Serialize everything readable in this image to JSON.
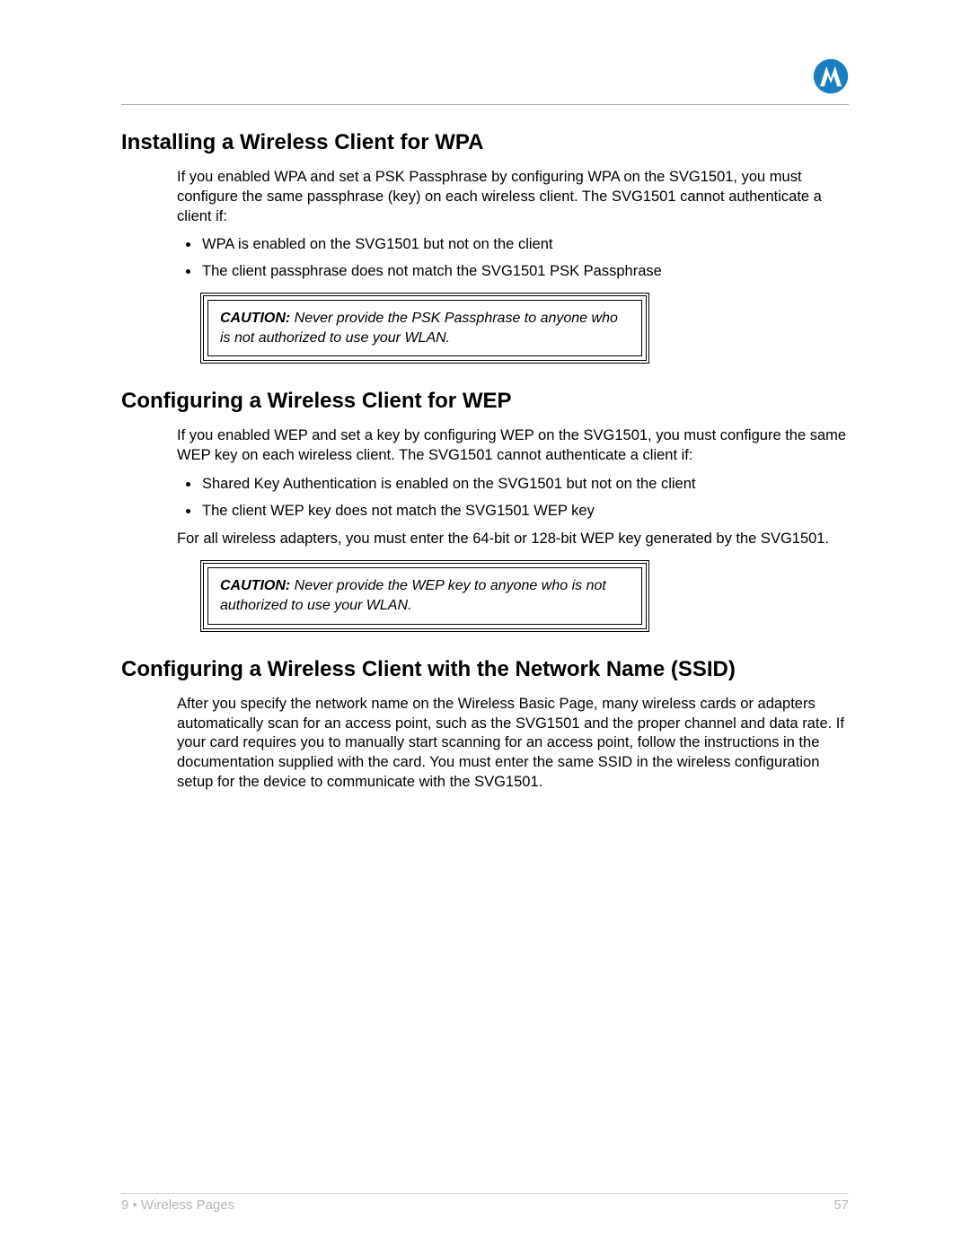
{
  "sections": [
    {
      "heading": "Installing a Wireless Client for WPA",
      "intro": "If you enabled WPA and set a PSK Passphrase by configuring WPA on the SVG1501, you must configure the same passphrase (key) on each wireless client. The SVG1501 cannot authenticate a client if:",
      "bullets": [
        "WPA is enabled on the SVG1501 but not on the client",
        "The client passphrase does not match the SVG1501 PSK Passphrase"
      ],
      "after": "",
      "caution_label": "CAUTION:",
      "caution_text": " Never provide the PSK Passphrase to anyone who is not authorized to use your WLAN."
    },
    {
      "heading": "Configuring a Wireless Client for WEP",
      "intro": "If you enabled WEP and set a key by configuring WEP on the SVG1501, you must configure the same WEP key on each wireless client. The SVG1501 cannot authenticate a client if:",
      "bullets": [
        "Shared Key Authentication is enabled on the SVG1501 but not on the client",
        "The client WEP key does not match the SVG1501 WEP key"
      ],
      "after": "For all wireless adapters, you must enter the 64-bit or 128-bit WEP key generated by the SVG1501.",
      "caution_label": "CAUTION:",
      "caution_text": " Never provide the WEP key to anyone who is not authorized to use your WLAN."
    },
    {
      "heading": "Configuring a Wireless Client with the Network Name (SSID)",
      "intro": "After you specify the network name on the Wireless Basic Page, many wireless cards or adapters automatically scan for an access point, such as the SVG1501 and the proper channel and data rate. If your card requires you to manually start scanning for an access point, follow the instructions in the documentation supplied with the card. You must enter the same SSID in the wireless configuration setup for the device to communicate with the SVG1501.",
      "bullets": [],
      "after": "",
      "caution_label": "",
      "caution_text": ""
    }
  ],
  "footer": {
    "left": "9 • Wireless Pages",
    "right": "57"
  },
  "logo_color": "#1a7fc1"
}
